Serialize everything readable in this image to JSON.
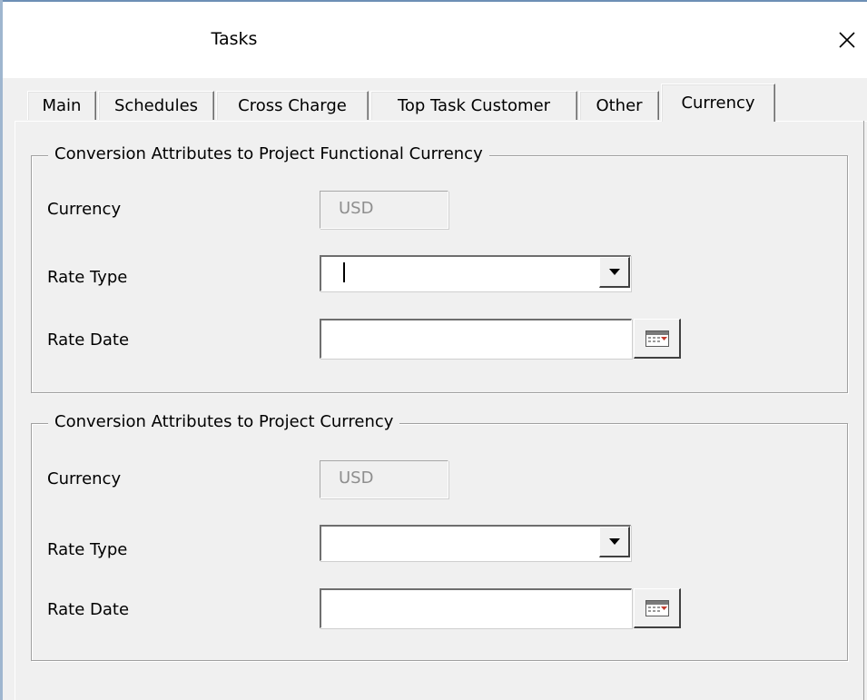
{
  "window": {
    "title": "Tasks",
    "close_glyph": "×"
  },
  "tabs": [
    {
      "label": "Main",
      "active": false
    },
    {
      "label": "Schedules",
      "active": false
    },
    {
      "label": "Cross Charge",
      "active": false
    },
    {
      "label": "Top Task Customer",
      "active": false
    },
    {
      "label": "Other",
      "active": false
    },
    {
      "label": "Currency",
      "active": true
    }
  ],
  "functional_group": {
    "title": "Conversion Attributes to Project Functional Currency",
    "currency_label": "Currency",
    "currency_value": "USD",
    "rate_type_label": "Rate Type",
    "rate_type_value": "",
    "rate_date_label": "Rate Date",
    "rate_date_value": ""
  },
  "project_group": {
    "title": "Conversion Attributes to Project Currency",
    "currency_label": "Currency",
    "currency_value": "USD",
    "rate_type_label": "Rate Type",
    "rate_type_value": "",
    "rate_date_label": "Rate Date",
    "rate_date_value": ""
  },
  "icons": {
    "close": "close-icon",
    "dropdown": "chevron-down-icon",
    "calendar": "calendar-icon"
  },
  "colors": {
    "window_bg": "#f0f0f0",
    "title_bg": "#ffffff",
    "readonly_text": "#8e8e8e",
    "calendar_accent": "#c0392b"
  }
}
